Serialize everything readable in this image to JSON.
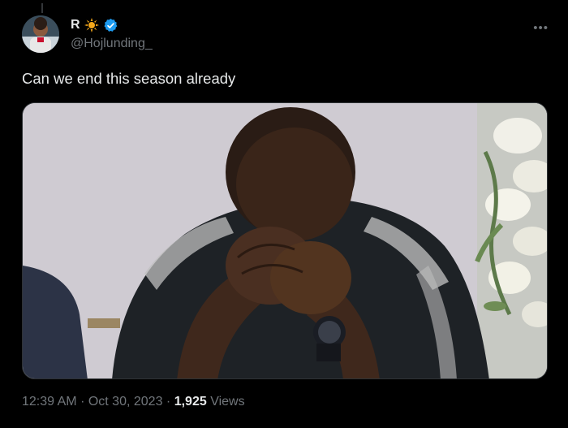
{
  "tweet": {
    "author": {
      "display_name": "R",
      "display_emoji": "☀",
      "handle": "@Hojlunding_",
      "verified": true
    },
    "text": "Can we end this season already",
    "timestamp": {
      "time": "12:39 AM",
      "separator": "·",
      "date": "Oct 30, 2023"
    },
    "views": {
      "count": "1,925",
      "label": "Views"
    },
    "more_icon": "more-horizontal-icon",
    "media_alt": "photo"
  },
  "colors": {
    "background": "#000000",
    "text_primary": "#e7e9ea",
    "text_secondary": "#71767b",
    "verified_blue": "#1d9bf0",
    "sun_emoji": "#f6a91b"
  }
}
